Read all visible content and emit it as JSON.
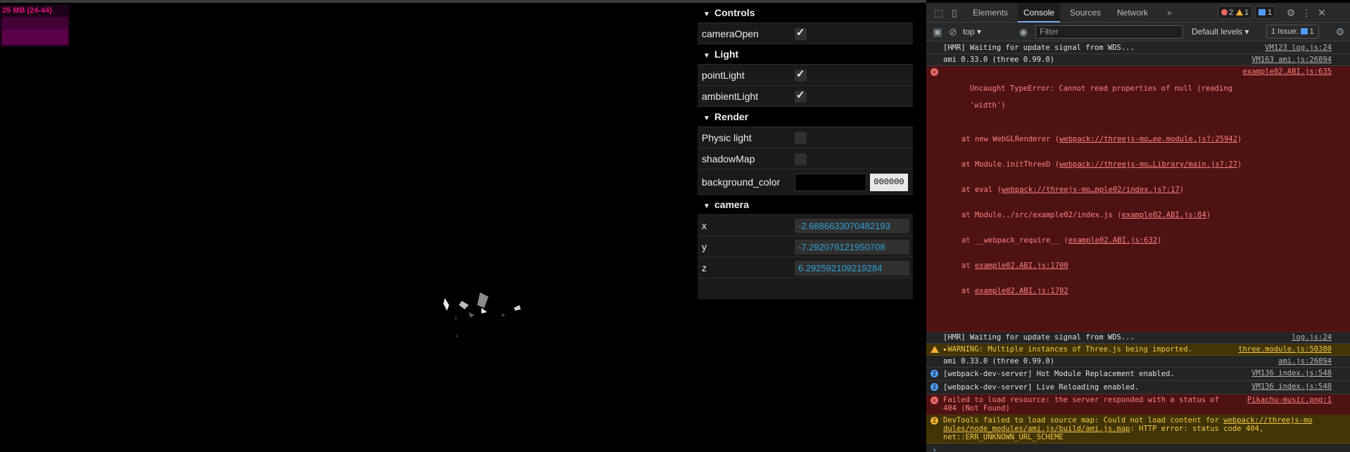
{
  "stats": {
    "text": "25 MB (24-44)"
  },
  "gui": {
    "folders": {
      "controls": {
        "title": "Controls",
        "cameraOpen": {
          "label": "cameraOpen",
          "checked": true
        }
      },
      "light": {
        "title": "Light",
        "pointLight": {
          "label": "pointLight",
          "checked": true
        },
        "ambientLight": {
          "label": "ambientLight",
          "checked": true
        }
      },
      "render": {
        "title": "Render",
        "physicLight": {
          "label": "Physic light",
          "checked": false
        },
        "shadowMap": {
          "label": "shadowMap",
          "checked": false
        },
        "background": {
          "label": "background_color",
          "value": "000000"
        }
      },
      "camera": {
        "title": "camera",
        "x": {
          "label": "x",
          "value": "-2.6886633070482193"
        },
        "y": {
          "label": "y",
          "value": "-7.292076121950708"
        },
        "z": {
          "label": "z",
          "value": "6.292592109219284"
        }
      }
    }
  },
  "devtools": {
    "tabs": [
      "Elements",
      "Console",
      "Sources",
      "Network"
    ],
    "active_tab": "Console",
    "more": "»",
    "counts": {
      "errors": "2",
      "warnings": "1",
      "info": "1"
    },
    "context": "top",
    "filter_placeholder": "Filter",
    "levels": "Default levels",
    "issues": {
      "label": "1 Issue:",
      "count": "1"
    },
    "messages": [
      {
        "type": "log",
        "text": "[HMR] Waiting for update signal from WDS...",
        "source": "VM123 log.js:24"
      },
      {
        "type": "log",
        "text": "ami 0.33.0 (three 0.99.0)",
        "source": "VM163 ami.js:26894"
      },
      {
        "type": "error",
        "text": "Uncaught TypeError: Cannot read properties of null (reading",
        "text2": "'width')",
        "source": "example02.ABI.js:635",
        "stack": [
          {
            "pre": "at new WebGLRenderer (",
            "link": "webpack://threejs-mo…ee.module.js?:25942",
            "post": ")"
          },
          {
            "pre": "at Module.initThreeD (",
            "link": "webpack://threejs-mo…Library/main.js?:27",
            "post": ")"
          },
          {
            "pre": "at eval (",
            "link": "webpack://threejs-mo…mple02/index.js?:17",
            "post": ")"
          },
          {
            "pre": "at Module../src/example02/index.js (",
            "link": "example02.ABI.js:84",
            "post": ")"
          },
          {
            "pre": "at __webpack_require__ (",
            "link": "example02.ABI.js:632",
            "post": ")"
          },
          {
            "pre": "at ",
            "link": "example02.ABI.js:1700",
            "post": ""
          },
          {
            "pre": "at ",
            "link": "example02.ABI.js:1702",
            "post": ""
          }
        ]
      },
      {
        "type": "log",
        "text": "[HMR] Waiting for update signal from WDS...",
        "source": "log.js:24"
      },
      {
        "type": "warning",
        "text": "▸WARNING: Multiple instances of Three.js being imported.",
        "source": "three.module.js:50380"
      },
      {
        "type": "log",
        "text": "ami 0.33.0 (three 0.99.0)",
        "source": "ami.js:26894"
      },
      {
        "type": "info",
        "badge": "2",
        "text": "[webpack-dev-server] Hot Module Replacement enabled.",
        "source": "VM136 index.js:548"
      },
      {
        "type": "info",
        "badge": "2",
        "text": "[webpack-dev-server] Live Reloading enabled.",
        "source": "VM136 index.js:548"
      },
      {
        "type": "error",
        "text": "Failed to load resource: the server responded with a status of",
        "text2": "404 (Not Found)",
        "source": "Pikachu-music.png:1"
      },
      {
        "type": "warning2",
        "badge": "2",
        "text": "DevTools failed to load source map: Could not load content for ",
        "link": "webpack://threejs-mo",
        "text2link": "dules/node_modules/ami.js/build/ami.js.map",
        "text2": ": HTTP error: status code 404,",
        "text3": "net::ERR_UNKNOWN_URL_SCHEME"
      }
    ],
    "prompt": "›"
  }
}
